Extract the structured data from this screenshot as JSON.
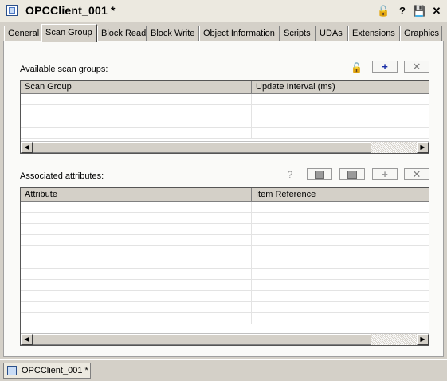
{
  "window": {
    "title": "OPCClient_001 *",
    "buttons": [
      {
        "name": "lock-icon",
        "glyph": "🔓"
      },
      {
        "name": "help-icon",
        "glyph": "?"
      },
      {
        "name": "save-icon",
        "glyph": "💾"
      },
      {
        "name": "close-icon",
        "glyph": "✕"
      }
    ]
  },
  "tabs": [
    {
      "label": "General",
      "active": false
    },
    {
      "label": "Scan Group",
      "active": true
    },
    {
      "label": "Block Read",
      "active": false
    },
    {
      "label": "Block Write",
      "active": false
    },
    {
      "label": "Object Information",
      "active": false
    },
    {
      "label": "Scripts",
      "active": false
    },
    {
      "label": "UDAs",
      "active": false
    },
    {
      "label": "Extensions",
      "active": false
    },
    {
      "label": "Graphics",
      "active": false
    }
  ],
  "scan_groups": {
    "label": "Available scan groups:",
    "columns": [
      "Scan Group",
      "Update Interval (ms)"
    ],
    "rows": []
  },
  "attributes": {
    "label": "Associated attributes:",
    "columns": [
      "Attribute",
      "Item Reference"
    ],
    "rows": []
  },
  "toolbar_glyphs": {
    "add": "+",
    "remove": "✕"
  },
  "scroll_arrows": {
    "left": "◀",
    "right": "▶"
  },
  "document_tab": {
    "label": "OPCClient_001 *"
  }
}
